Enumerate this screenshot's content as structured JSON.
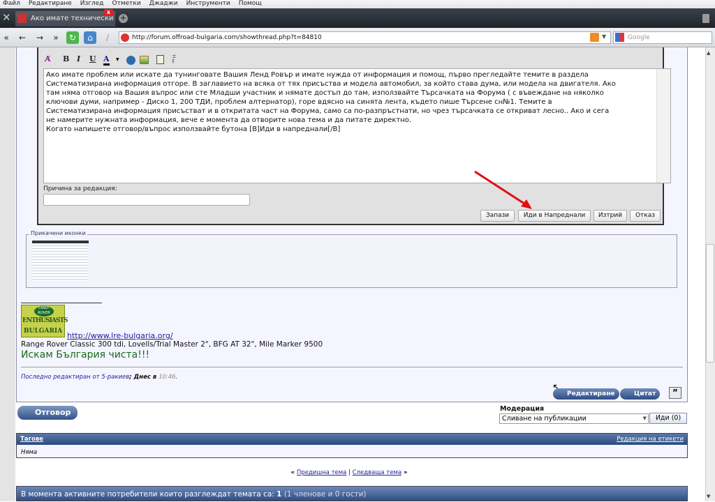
{
  "menu": [
    "Файл",
    "Редактиране",
    "Изглед",
    "Отметки",
    "Джаджи",
    "Инструменти",
    "Помощ"
  ],
  "tab": {
    "title": "Ако имате технически ...",
    "close": "x"
  },
  "address": {
    "url": "http://forum.offroad-bulgaria.com/showthread.php?t=84810",
    "search_placeholder": "Google"
  },
  "editor": {
    "toolbar": {
      "bold": "B",
      "italic": "I",
      "underline": "U",
      "color": "A"
    },
    "text": "Ако имате проблем или искате да тунинговате Вашия Ленд Ровър и имате нужда от информация и помощ, първо прегледайте темите в раздела\nСистематизирана информация отгоре. В заглавието на всяка от тях присъства и модела автомобил, за който става дума, или модела на двигателя. Ако\nтам няма отговор на Вашия въпрос или сте Младши участник и нямате достъп до там, използвайте Търсачката на Форума ( с въвеждане на няколко\nключови думи, например - Диско 1, 200 ТДИ, проблем алтернатор), горе вдясно на синята лента, където пише Търсене сн№1. Темите в\nСистематизирана информация присъстват и в откритата част на Форума, само са по-разпръстнати, но чрез търсачката се откриват лесно.. Ако и сега\nне намерите нужната информация, вече е момента да отворите нова тема и да питате директно.\nКогато напишете отговор/въпрос използвайте бутона [B]Иди в напреднали[/B]",
    "reason_label": "Причина за редакция:",
    "reason_value": "",
    "buttons": {
      "save": "Запази",
      "advanced": "Иди в Напреднали",
      "delete": "Изтрий",
      "cancel": "Отказ"
    }
  },
  "attachments": {
    "legend": "Прикачени иконки"
  },
  "signature": {
    "logo_text": [
      "LAND-ROVER",
      "ENTHUSIASTS",
      "BULGARIA"
    ],
    "link": "http://www.lre-bulgaria.org/",
    "car": "Range Rover Classic 300 tdi, Lovells/Trial Master 2\", BFG AT 32\", Mile Marker 9500",
    "slogan": "Искам България чиста!!!"
  },
  "edited": {
    "link": "Последно редактиран от 5-ракиев",
    "when": "; Днес в ",
    "time": "10:46",
    "end": "."
  },
  "post_buttons": {
    "edit": "Редактиране",
    "quote": "Цитат"
  },
  "reply": "Отговор",
  "moderation": {
    "label": "Модерация",
    "selected": "Сливане на публикации",
    "go": "Иди (0)"
  },
  "tags": {
    "title": "Тагове",
    "edit": "Редакция на етикети",
    "value": "Няма"
  },
  "thread_nav": {
    "prev": "Предишна тема",
    "sep": " | ",
    "next": "Следваща тема",
    "lq": "« ",
    "rq": " »"
  },
  "active": {
    "text": "В момента активните потребители които разглеждат темата са: ",
    "count": "1",
    "detail": " (1 членове и 0 гости)"
  },
  "colors": {
    "header_blue": "#2c4a7c",
    "slogan_green": "#1a6a1a",
    "arrow_red": "#e01010"
  }
}
